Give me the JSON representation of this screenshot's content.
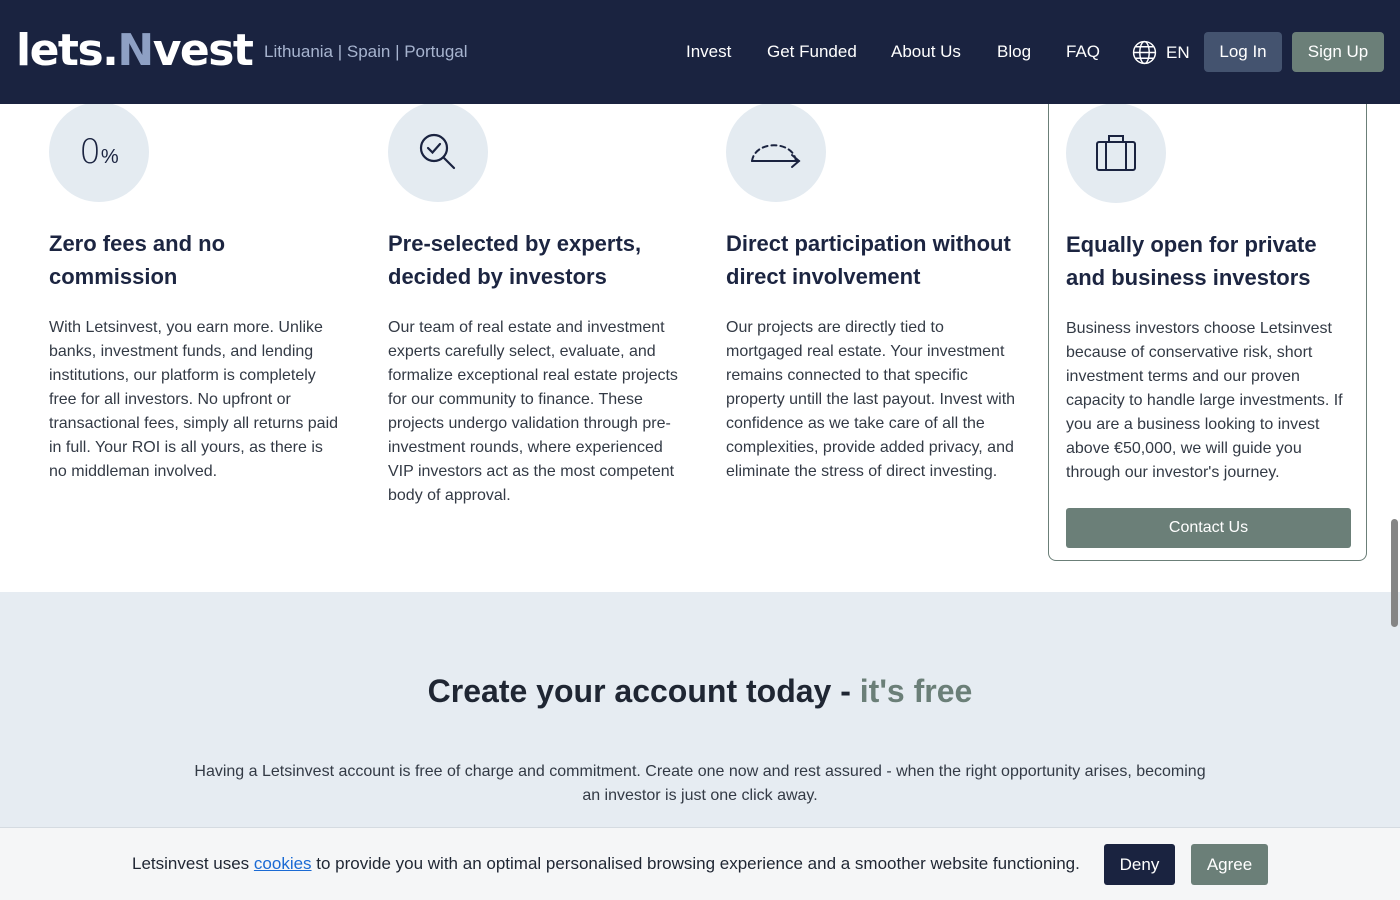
{
  "header": {
    "logo_parts": [
      "lets.",
      "N",
      "vest"
    ],
    "countries": "Lithuania | Spain | Portugal",
    "nav": [
      "Invest",
      "Get Funded",
      "About Us",
      "Blog",
      "FAQ"
    ],
    "language": "EN",
    "login_label": "Log In",
    "signup_label": "Sign Up"
  },
  "features": [
    {
      "icon": "zero-percent-icon",
      "icon_text": "0",
      "icon_sub": "%",
      "title": "Zero fees and no commission",
      "body": "With Letsinvest, you earn more. Unlike banks, investment funds, and lending institutions, our platform is completely free for all investors. No upfront or transactional fees, simply all returns paid in full. Your ROI is all yours, as there is no middleman involved."
    },
    {
      "icon": "magnifier-check-icon",
      "title": "Pre-selected by experts, decided by investors",
      "body": "Our team of real estate and investment experts carefully select, evaluate, and formalize exceptional real estate projects for our community to finance. These projects undergo validation through pre-investment rounds, where experienced VIP investors act as the most competent body of approval."
    },
    {
      "icon": "dashed-arc-arrow-icon",
      "title": "Direct participation without direct involvement",
      "body": "Our projects are directly tied to mortgaged real estate. Your investment remains connected to that specific property untill the last payout. Invest with confidence as we take care of all the complexities, provide added privacy, and eliminate the stress of direct investing."
    },
    {
      "icon": "briefcase-icon",
      "title": "Equally open for private and business investors",
      "body": "Business investors choose Letsinvest because of conservative risk, short investment terms and our proven capacity to handle large investments. If you are a business looking to invest above €50,000, we will guide you through our investor's journey.",
      "button_label": "Contact Us"
    }
  ],
  "cta": {
    "title_main": "Create your account today - ",
    "title_accent": "it's free",
    "text": "Having a Letsinvest account is free of charge and commitment. Create one now and rest assured - when the right opportunity arises, becoming an investor is just one click away."
  },
  "cookie": {
    "text_before": "Letsinvest uses ",
    "link": "cookies",
    "text_after": " to provide you with an optimal personalised browsing experience and a smoother website functioning.",
    "deny_label": "Deny",
    "agree_label": "Agree"
  },
  "colors": {
    "header_bg": "#1a2340",
    "accent_green": "#6b7f78",
    "login_bg": "#44536f",
    "icon_circle_bg": "#e4ebf1",
    "cta_bg": "#e6ecf2"
  }
}
